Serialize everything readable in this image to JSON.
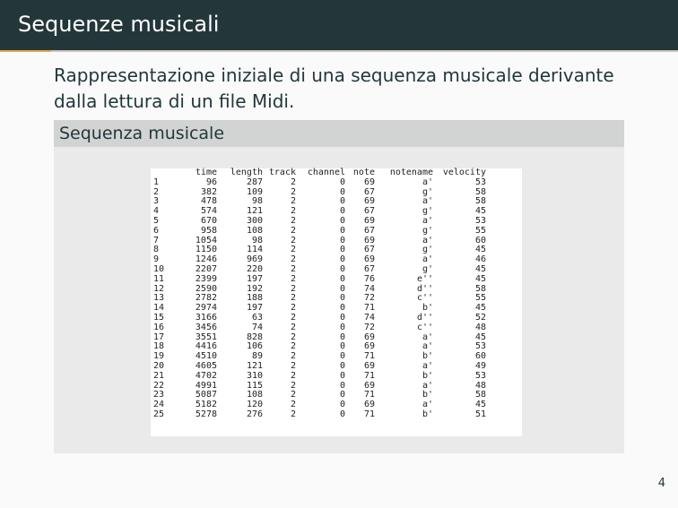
{
  "header": {
    "title": "Sequenze musicali"
  },
  "intro": {
    "text_before": "Rappresentazione iniziale di una sequenza musicale derivante dalla lettura di un file ",
    "midi": "Midi",
    "text_after": "."
  },
  "block": {
    "title": "Sequenza musicale",
    "table": {
      "columns": [
        "",
        "time",
        "length",
        "track",
        "channel",
        "note",
        "notename",
        "velocity"
      ],
      "rows": [
        [
          "1",
          "96",
          "287",
          "2",
          "0",
          "69",
          "a'",
          "53"
        ],
        [
          "2",
          "382",
          "109",
          "2",
          "0",
          "67",
          "g'",
          "58"
        ],
        [
          "3",
          "478",
          "98",
          "2",
          "0",
          "69",
          "a'",
          "58"
        ],
        [
          "4",
          "574",
          "121",
          "2",
          "0",
          "67",
          "g'",
          "45"
        ],
        [
          "5",
          "670",
          "300",
          "2",
          "0",
          "69",
          "a'",
          "53"
        ],
        [
          "6",
          "958",
          "108",
          "2",
          "0",
          "67",
          "g'",
          "55"
        ],
        [
          "7",
          "1054",
          "98",
          "2",
          "0",
          "69",
          "a'",
          "60"
        ],
        [
          "8",
          "1150",
          "114",
          "2",
          "0",
          "67",
          "g'",
          "45"
        ],
        [
          "9",
          "1246",
          "969",
          "2",
          "0",
          "69",
          "a'",
          "46"
        ],
        [
          "10",
          "2207",
          "220",
          "2",
          "0",
          "67",
          "g'",
          "45"
        ],
        [
          "11",
          "2399",
          "197",
          "2",
          "0",
          "76",
          "e''",
          "45"
        ],
        [
          "12",
          "2590",
          "192",
          "2",
          "0",
          "74",
          "d''",
          "58"
        ],
        [
          "13",
          "2782",
          "188",
          "2",
          "0",
          "72",
          "c''",
          "55"
        ],
        [
          "14",
          "2974",
          "197",
          "2",
          "0",
          "71",
          "b'",
          "45"
        ],
        [
          "15",
          "3166",
          "63",
          "2",
          "0",
          "74",
          "d''",
          "52"
        ],
        [
          "16",
          "3456",
          "74",
          "2",
          "0",
          "72",
          "c''",
          "48"
        ],
        [
          "17",
          "3551",
          "828",
          "2",
          "0",
          "69",
          "a'",
          "45"
        ],
        [
          "18",
          "4416",
          "106",
          "2",
          "0",
          "69",
          "a'",
          "53"
        ],
        [
          "19",
          "4510",
          "89",
          "2",
          "0",
          "71",
          "b'",
          "60"
        ],
        [
          "20",
          "4605",
          "121",
          "2",
          "0",
          "69",
          "a'",
          "49"
        ],
        [
          "21",
          "4702",
          "310",
          "2",
          "0",
          "71",
          "b'",
          "53"
        ],
        [
          "22",
          "4991",
          "115",
          "2",
          "0",
          "69",
          "a'",
          "48"
        ],
        [
          "23",
          "5087",
          "108",
          "2",
          "0",
          "71",
          "b'",
          "58"
        ],
        [
          "24",
          "5182",
          "120",
          "2",
          "0",
          "69",
          "a'",
          "45"
        ],
        [
          "25",
          "5278",
          "276",
          "2",
          "0",
          "71",
          "b'",
          "51"
        ]
      ]
    }
  },
  "footer": {
    "page_number": "4"
  },
  "colors": {
    "header_bg": "#23373b",
    "accent": "#e0a84d",
    "block_title_bg": "#d2d4d4",
    "block_body_bg": "#eaeaea",
    "text": "#23373b"
  }
}
